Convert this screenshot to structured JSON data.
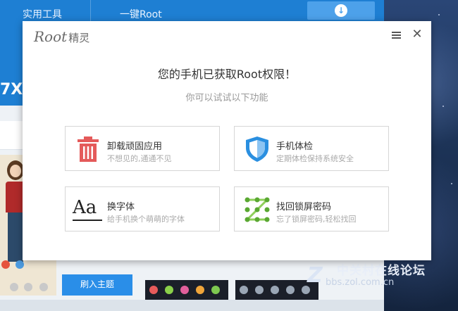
{
  "background_app": {
    "tabs": [
      "实用工具",
      "一键Root"
    ],
    "model_fragment": "7X",
    "theme_button": "刷入主题"
  },
  "watermark": {
    "name": "中关村在线论坛",
    "url": "bbs.zol.com.cn"
  },
  "dialog": {
    "logo_root": "Root",
    "logo_cn": "精灵",
    "title": "您的手机已获取Root权限！",
    "subtitle": "你可以试试以下功能",
    "features": [
      {
        "name": "卸载顽固应用",
        "desc": "不想见的,通通不见",
        "icon": "trash-icon"
      },
      {
        "name": "手机体检",
        "desc": "定期体检保持系统安全",
        "icon": "shield-icon"
      },
      {
        "name": "换字体",
        "desc": "给手机换个萌萌的字体",
        "icon": "font-icon",
        "glyph": "Aa"
      },
      {
        "name": "找回锁屏密码",
        "desc": "忘了锁屏密码,轻松找回",
        "icon": "pattern-lock-icon"
      }
    ]
  },
  "colors": {
    "accent_blue": "#1e7fd3",
    "trash_red": "#e45a5a",
    "shield_blue": "#2a8fe0",
    "pattern_green": "#5aa832"
  }
}
